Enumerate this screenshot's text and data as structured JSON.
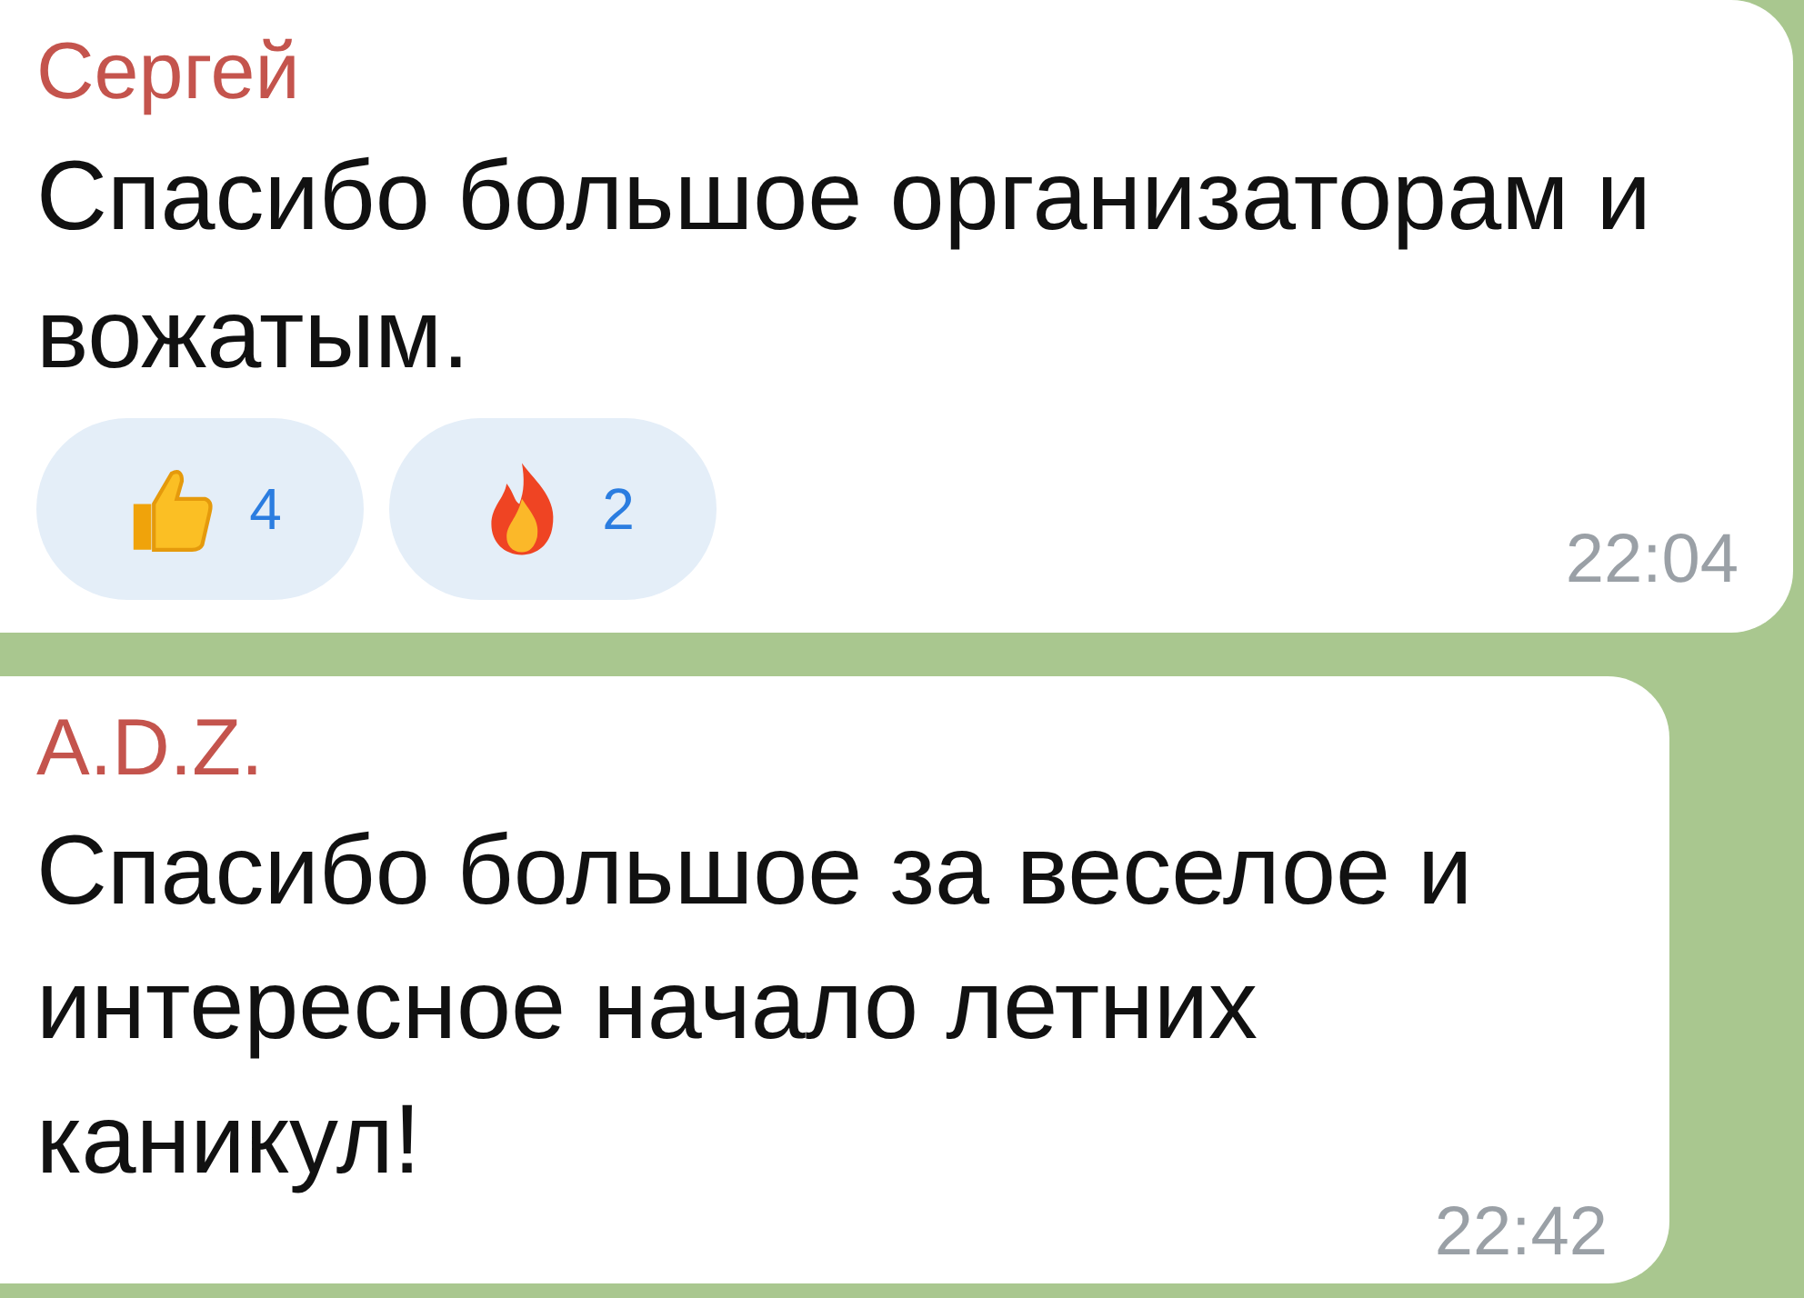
{
  "messages": [
    {
      "author": "Сергей",
      "text": "Спасибо большое организаторам и вожатым.",
      "reactions": [
        {
          "kind": "thumbs-up",
          "count": "4"
        },
        {
          "kind": "fire",
          "count": "2"
        }
      ],
      "time": "22:04"
    },
    {
      "author": "A.D.Z.",
      "text": "Спасибо большое за веселое и интересное начало летних каникул!",
      "time": "22:42"
    }
  ]
}
